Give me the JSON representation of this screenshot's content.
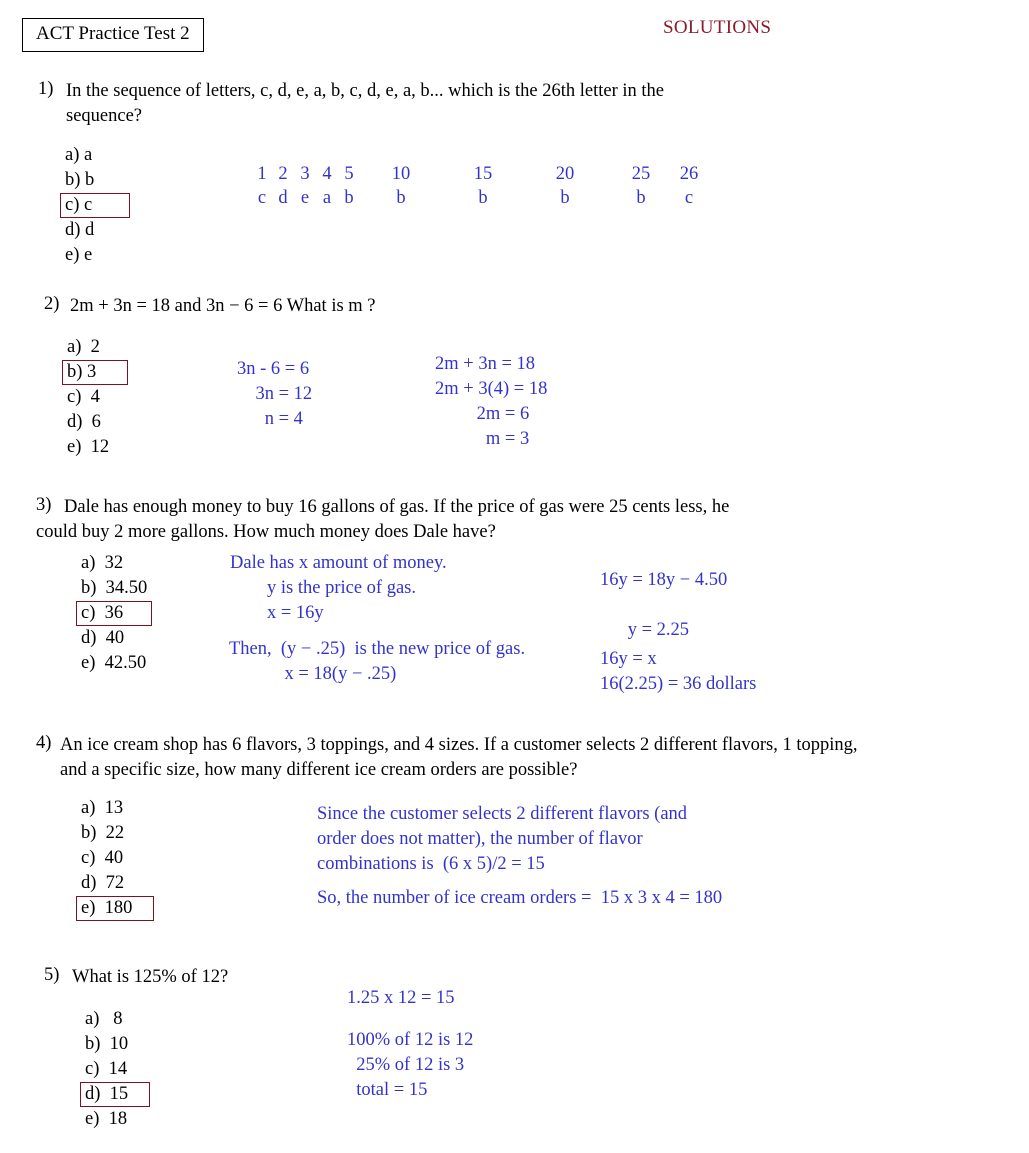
{
  "header": {
    "title": "ACT Practice Test 2",
    "solutions_label": "SOLUTIONS",
    "solutions_color": "#8b1a2b",
    "work_color": "#3333cc",
    "box_color": "#7d1220"
  },
  "questions": [
    {
      "number": "1)",
      "text_line1": "In the sequence of letters,    c, d, e, a, b, c, d, e, a, b...   which is the 26th letter in the",
      "text_line2": "sequence?",
      "choices": [
        {
          "label": "a)",
          "value": "a",
          "boxed": false
        },
        {
          "label": "b)",
          "value": "b",
          "boxed": false
        },
        {
          "label": "c)",
          "value": "c",
          "boxed": true
        },
        {
          "label": "d)",
          "value": "d",
          "boxed": false
        },
        {
          "label": "e)",
          "value": "e",
          "boxed": false
        }
      ],
      "work": {
        "positions_row": [
          "1",
          "2",
          "3",
          "4",
          "5"
        ],
        "letters_row": [
          "c",
          "d",
          "e",
          "a",
          "b"
        ],
        "marks": [
          {
            "position": "10",
            "letter": "b"
          },
          {
            "position": "15",
            "letter": "b"
          },
          {
            "position": "20",
            "letter": "b"
          },
          {
            "position": "25",
            "letter": "b"
          },
          {
            "position": "26",
            "letter": "c"
          }
        ]
      }
    },
    {
      "number": "2)",
      "text_line1": "2m + 3n = 18     and    3n − 6 = 6     What is m ?",
      "choices": [
        {
          "label": "a)",
          "value": "2",
          "boxed": false
        },
        {
          "label": "b)",
          "value": "3",
          "boxed": true
        },
        {
          "label": "c)",
          "value": "4",
          "boxed": false
        },
        {
          "label": "d)",
          "value": "6",
          "boxed": false
        },
        {
          "label": "e)",
          "value": "12",
          "boxed": false
        }
      ],
      "work_left": "3n - 6 = 6\n    3n = 12\n      n = 4",
      "work_right": "2m + 3n = 18\n2m + 3(4) = 18\n         2m = 6\n           m = 3"
    },
    {
      "number": "3)",
      "text_line1": "Dale has enough money to buy 16 gallons of gas.  If the price of gas were 25 cents less, he",
      "text_line2": "could buy 2 more gallons.  How much money does Dale have?",
      "choices": [
        {
          "label": "a)",
          "value": "32",
          "boxed": false
        },
        {
          "label": "b)",
          "value": "34.50",
          "boxed": false
        },
        {
          "label": "c)",
          "value": "36",
          "boxed": true
        },
        {
          "label": "d)",
          "value": "40",
          "boxed": false
        },
        {
          "label": "e)",
          "value": "42.50",
          "boxed": false
        }
      ],
      "work_mid_top": "Dale has x amount of money.\n        y is the price of gas.\n        x = 16y",
      "work_mid_bottom": "Then,  (y − .25)  is the new price of gas.\n            x = 18(y − .25)",
      "work_right_top": "16y = 18y − 4.50\n\n      y = 2.25",
      "work_right_bottom": "16y = x\n16(2.25) = 36 dollars"
    },
    {
      "number": "4)",
      "text_line1": "An ice cream shop has 6 flavors, 3 toppings, and 4 sizes.  If a customer selects 2 different flavors, 1 topping,",
      "text_line2": "and a specific size, how many different ice cream orders are possible?",
      "choices": [
        {
          "label": "a)",
          "value": "13",
          "boxed": false
        },
        {
          "label": "b)",
          "value": "22",
          "boxed": false
        },
        {
          "label": "c)",
          "value": "40",
          "boxed": false
        },
        {
          "label": "d)",
          "value": "72",
          "boxed": false
        },
        {
          "label": "e)",
          "value": "180",
          "boxed": true
        }
      ],
      "work_top": "Since the customer selects 2 different flavors (and\norder does not matter), the number of flavor\ncombinations is  (6 x 5)/2 = 15",
      "work_bottom": "So, the number of ice cream orders =  15 x 3 x 4 = 180"
    },
    {
      "number": "5)",
      "text_line1": "What is 125% of 12?",
      "choices": [
        {
          "label": "a)",
          "value": "8",
          "boxed": false
        },
        {
          "label": "b)",
          "value": "10",
          "boxed": false
        },
        {
          "label": "c)",
          "value": "14",
          "boxed": false
        },
        {
          "label": "d)",
          "value": "15",
          "boxed": true
        },
        {
          "label": "e)",
          "value": "18",
          "boxed": false
        }
      ],
      "work_top": "1.25 x 12 = 15",
      "work_bottom": "100% of 12 is 12\n  25% of 12 is 3\n  total = 15"
    }
  ]
}
